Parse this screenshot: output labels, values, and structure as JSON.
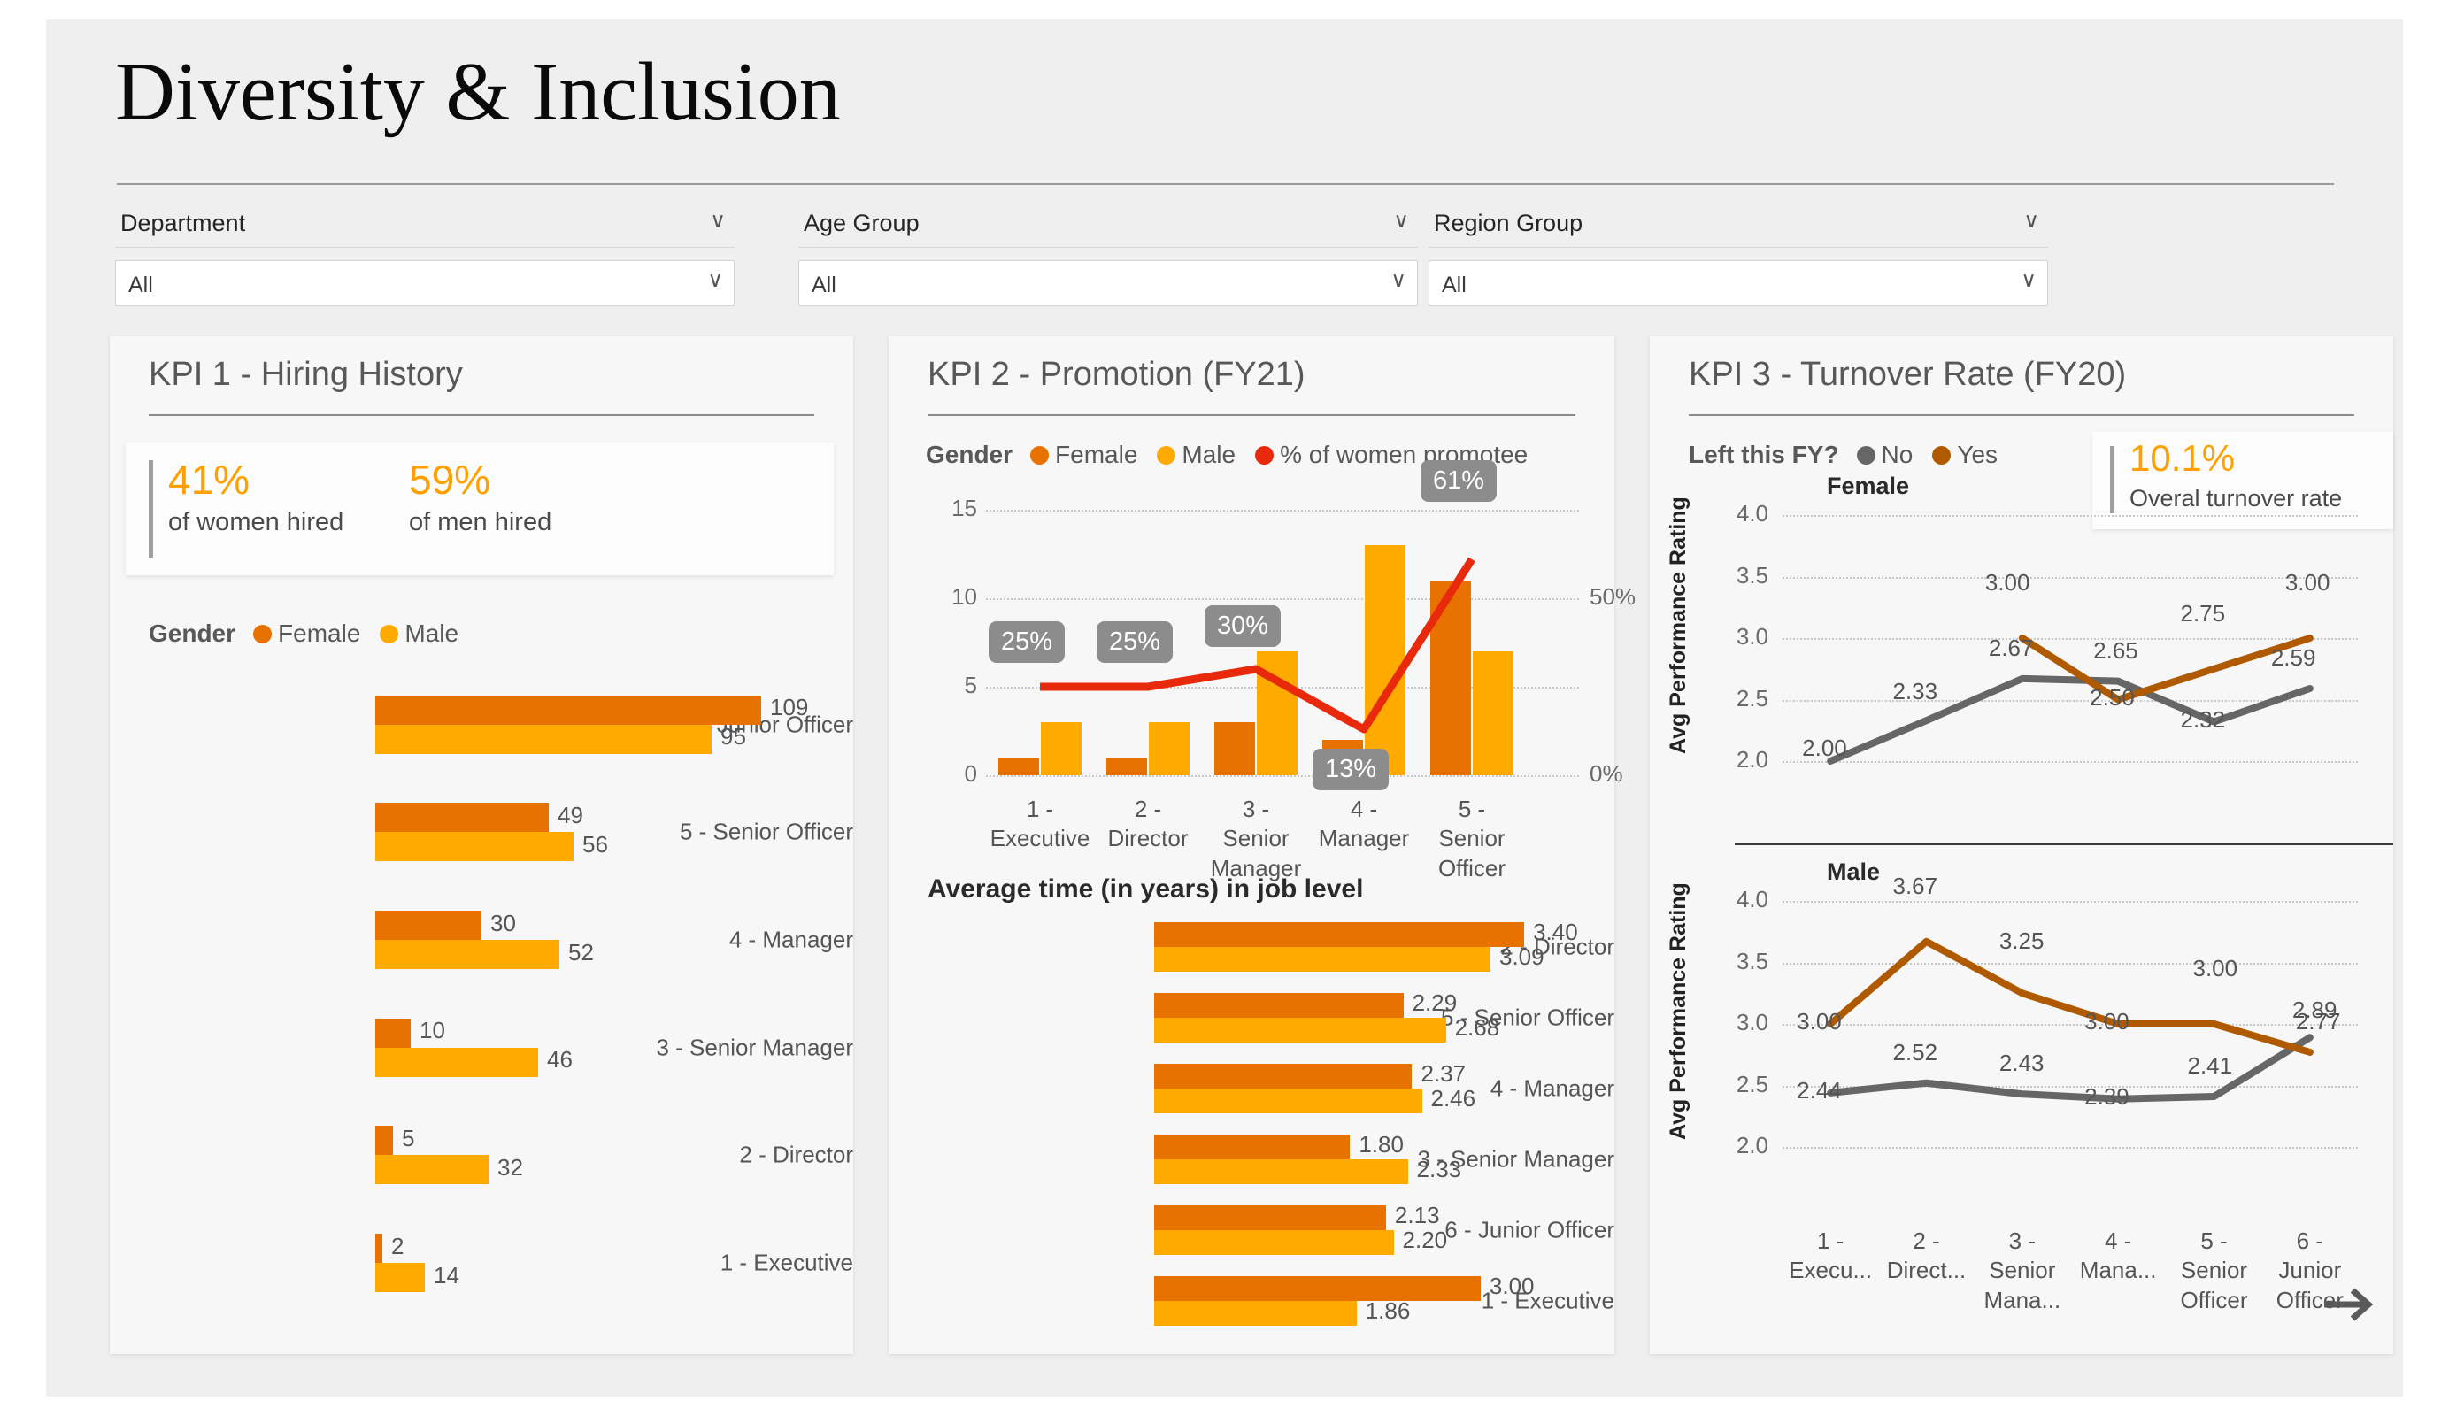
{
  "page": {
    "title": "Diversity & Inclusion"
  },
  "colors": {
    "female": "#E87200",
    "male": "#FFAA00",
    "percent_line": "#E8290B",
    "left_yes": "#B05A00",
    "left_no": "#666666",
    "accent_stat": "#FFA000",
    "callout_bg": "#8C8C8C"
  },
  "slicers": [
    {
      "label": "Department",
      "value": "All",
      "chevron": "chevron-down"
    },
    {
      "label": "Age Group",
      "value": "All",
      "chevron": "chevron-down"
    },
    {
      "label": "Region Group",
      "value": "All",
      "chevron": "chevron-down"
    }
  ],
  "kpi1": {
    "title": "KPI 1 - Hiring History",
    "stats": [
      {
        "value": "41%",
        "label": "of women hired"
      },
      {
        "value": "59%",
        "label": "of men hired"
      }
    ],
    "legend_title": "Gender",
    "legend": [
      {
        "label": "Female",
        "color": "#E87200"
      },
      {
        "label": "Male",
        "color": "#FFAA00"
      }
    ],
    "chart_data": {
      "type": "bar",
      "orientation": "horizontal",
      "title": "KPI 1 - Hiring History",
      "categories": [
        "6 - Junior Officer",
        "5 - Senior Officer",
        "4 - Manager",
        "3 - Senior Manager",
        "2 - Director",
        "1 - Executive"
      ],
      "series": [
        {
          "name": "Female",
          "color": "#E87200",
          "values": [
            109,
            49,
            30,
            10,
            5,
            2
          ]
        },
        {
          "name": "Male",
          "color": "#FFAA00",
          "values": [
            95,
            56,
            52,
            46,
            32,
            14
          ]
        }
      ],
      "xlabel": "",
      "ylabel": "",
      "xlim": [
        0,
        120
      ],
      "grid": false
    }
  },
  "kpi2": {
    "title": "KPI 2 - Promotion (FY21)",
    "legend_title": "Gender",
    "legend": [
      {
        "label": "Female",
        "color": "#E87200"
      },
      {
        "label": "Male",
        "color": "#FFAA00"
      },
      {
        "label": "% of women promotee",
        "color": "#E8290B"
      }
    ],
    "chart_data": {
      "type": "bar",
      "subtype": "combo-column-line",
      "title": "KPI 2 - Promotion (FY21)",
      "categories": [
        "1 - Executive",
        "2 - Director",
        "3 - Senior Manager",
        "4 - Manager",
        "5 - Senior Officer"
      ],
      "series": [
        {
          "name": "Female",
          "color": "#E87200",
          "axis": "left",
          "values": [
            1,
            1,
            3,
            2,
            11
          ]
        },
        {
          "name": "Male",
          "color": "#FFAA00",
          "axis": "left",
          "values": [
            3,
            3,
            7,
            13,
            7
          ]
        },
        {
          "name": "% of women promotee",
          "color": "#E8290B",
          "axis": "right",
          "type": "line",
          "values": [
            25,
            25,
            30,
            13,
            61
          ],
          "data_labels": [
            "25%",
            "25%",
            "30%",
            "13%",
            "61%"
          ]
        }
      ],
      "ylabel": "",
      "ylim": [
        0,
        15
      ],
      "yticks": [
        0,
        5,
        10,
        15
      ],
      "y2lim": [
        0,
        75
      ],
      "y2ticks_shown": [
        "0%",
        "50%"
      ],
      "grid": true
    },
    "subchart": {
      "title": "Average time (in years) in job level",
      "chart_data": {
        "type": "bar",
        "orientation": "horizontal",
        "title": "Average time (in years) in job level",
        "categories": [
          "2 - Director",
          "5 - Senior Officer",
          "4 - Manager",
          "3 - Senior Manager",
          "6 - Junior Officer",
          "1 - Executive"
        ],
        "series": [
          {
            "name": "Female",
            "color": "#E87200",
            "values": [
              3.4,
              2.29,
              2.37,
              1.8,
              2.13,
              3.0
            ]
          },
          {
            "name": "Male",
            "color": "#FFAA00",
            "values": [
              3.09,
              2.68,
              2.46,
              2.33,
              2.2,
              1.86
            ]
          }
        ],
        "xlim": [
          0,
          3.7
        ],
        "grid": false
      }
    }
  },
  "kpi3": {
    "title": "KPI 3 - Turnover Rate (FY20)",
    "legend_title": "Left this FY?",
    "legend": [
      {
        "label": "No",
        "color": "#666666"
      },
      {
        "label": "Yes",
        "color": "#B05A00"
      }
    ],
    "callout": {
      "value": "10.1%",
      "label": "Overal turnover rate"
    },
    "nav_arrow": "arrow-right",
    "chart_data": [
      {
        "type": "line",
        "title": "Female",
        "categories": [
          "1 - Execu...",
          "2 - Direct...",
          "3 - Senior Mana...",
          "4 - Mana...",
          "5 - Senior Officer",
          "6 - Junior Officer"
        ],
        "series": [
          {
            "name": "No",
            "color": "#666666",
            "values": [
              2.0,
              2.33,
              2.67,
              2.65,
              2.32,
              2.59
            ],
            "data_labels": [
              "2.00",
              "2.33",
              "2.67",
              "2.65",
              "2.32",
              "2.59"
            ]
          },
          {
            "name": "Yes",
            "color": "#B05A00",
            "values": [
              null,
              null,
              3.0,
              2.5,
              2.75,
              3.0
            ],
            "data_labels": [
              null,
              null,
              "3.00",
              "2.50",
              "2.75",
              "3.00"
            ]
          }
        ],
        "ylabel": "Avg Performance Rating",
        "ylim": [
          2.0,
          4.0
        ],
        "yticks": [
          2.0,
          2.5,
          3.0,
          3.5,
          4.0
        ],
        "ytick_labels": [
          "2.0",
          "2.5",
          "3.0",
          "3.5",
          "4.0"
        ],
        "grid": true
      },
      {
        "type": "line",
        "title": "Male",
        "categories": [
          "1 - Execu...",
          "2 - Direct...",
          "3 - Senior Mana...",
          "4 - Mana...",
          "5 - Senior Officer",
          "6 - Junior Officer"
        ],
        "series": [
          {
            "name": "No",
            "color": "#666666",
            "values": [
              2.44,
              2.52,
              2.43,
              2.39,
              2.41,
              2.89
            ],
            "data_labels": [
              "2.44",
              "2.52",
              "2.43",
              "2.39",
              "2.41",
              "2.89"
            ]
          },
          {
            "name": "Yes",
            "color": "#B05A00",
            "values": [
              3.0,
              3.67,
              3.25,
              3.0,
              3.0,
              2.77
            ],
            "data_labels": [
              "3.00",
              "3.67",
              "3.25",
              "3.00",
              "3.00",
              "2.77"
            ]
          }
        ],
        "ylabel": "Avg Performance Rating",
        "ylim": [
          2.0,
          4.0
        ],
        "yticks": [
          2.0,
          2.5,
          3.0,
          3.5,
          4.0
        ],
        "ytick_labels": [
          "2.0",
          "2.5",
          "3.0",
          "3.5",
          "4.0"
        ],
        "grid": true
      }
    ]
  }
}
